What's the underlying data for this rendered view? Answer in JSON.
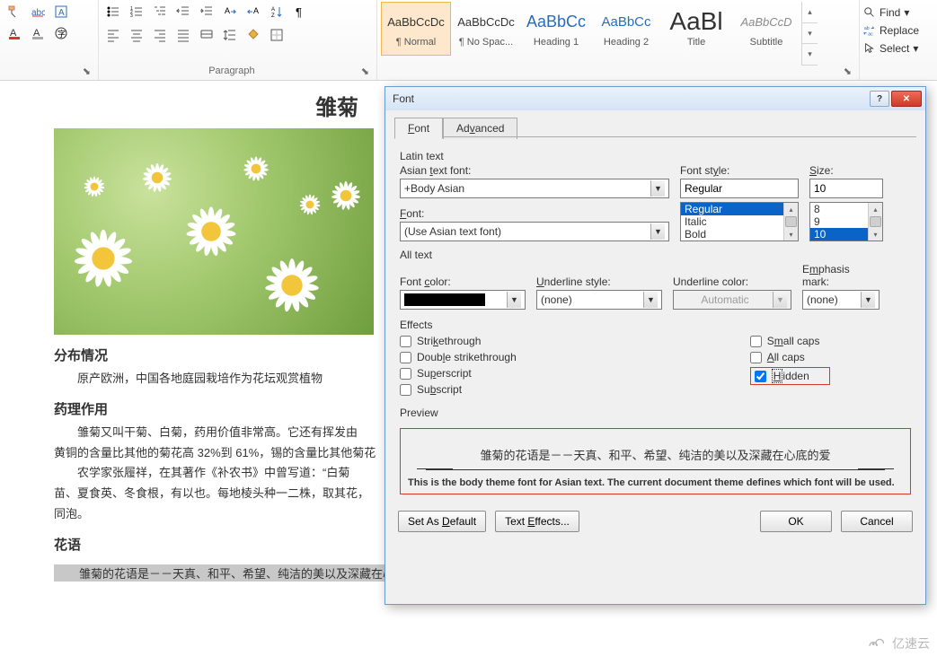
{
  "ribbon": {
    "styles": [
      {
        "sample": "AaBbCcDc",
        "name": "¶ Normal",
        "css": "font-size:13px;color:#333"
      },
      {
        "sample": "AaBbCcDc",
        "name": "¶ No Spac...",
        "css": "font-size:13px;color:#333"
      },
      {
        "sample": "AaBbCc",
        "name": "Heading 1",
        "css": "font-size:18px;color:#2a6bbf"
      },
      {
        "sample": "AaBbCc",
        "name": "Heading 2",
        "css": "font-size:15px;color:#2a6bbf"
      },
      {
        "sample": "AaBl",
        "name": "Title",
        "css": "font-size:28px;color:#333"
      },
      {
        "sample": "AaBbCcD",
        "name": "Subtitle",
        "css": "font-size:13px;color:#8a8a8a;font-style:italic"
      }
    ],
    "paragraph_label": "Paragraph",
    "editing": {
      "find": "Find",
      "replace": "Replace",
      "select": "Select"
    }
  },
  "document": {
    "title": "雏菊",
    "section1": "分布情况",
    "p1": "原产欧洲，中国各地庭园栽培作为花坛观赏植物",
    "section2": "药理作用",
    "p2a": "雏菊又叫干菊、白菊，药用价值非常高。它还有挥发由",
    "p2b": "黄铜的含量比其他的菊花高 32%到 61%，锡的含量比其他菊花",
    "p3a": "农学家张履祥，在其著作《补农书》中曾写道：“白菊",
    "p3b": "苗、夏食英、冬食根，有以也。每地棱头种一二株，取其花，",
    "p3c": "同泡。",
    "section3": "花语",
    "highlighted": "雏菊的花语是－－天真、和平、希望、纯洁的美以及深藏在心底的爱"
  },
  "dialog": {
    "title": "Font",
    "tabs": {
      "font": "Font",
      "advanced": "Advanced"
    },
    "latin_text": "Latin text",
    "asian_font_label": "Asian text font:",
    "asian_font_value": "+Body Asian",
    "font_label": "Font:",
    "font_value": "(Use Asian text font)",
    "font_style_label": "Font style:",
    "font_style_value": "Regular",
    "style_options": [
      "Regular",
      "Italic",
      "Bold"
    ],
    "size_label": "Size:",
    "size_value": "10",
    "size_options": [
      "8",
      "9",
      "10"
    ],
    "all_text": "All text",
    "font_color_label": "Font color:",
    "underline_style_label": "Underline style:",
    "underline_style_value": "(none)",
    "underline_color_label": "Underline color:",
    "underline_color_value": "Automatic",
    "emphasis_label": "Emphasis mark:",
    "emphasis_value": "(none)",
    "effects": "Effects",
    "eff": {
      "strikethrough": "Strikethrough",
      "double_strike": "Double strikethrough",
      "superscript": "Superscript",
      "subscript": "Subscript",
      "small_caps": "Small caps",
      "all_caps": "All caps",
      "hidden": "Hidden"
    },
    "preview": "Preview",
    "preview_text": "雏菊的花语是－－天真、和平、希望、纯洁的美以及深藏在心底的爱",
    "preview_desc": "This is the body theme font for Asian text. The current document theme defines which font will be used.",
    "buttons": {
      "set_default": "Set As Default",
      "text_effects": "Text Effects...",
      "ok": "OK",
      "cancel": "Cancel"
    }
  },
  "watermark": "亿速云"
}
